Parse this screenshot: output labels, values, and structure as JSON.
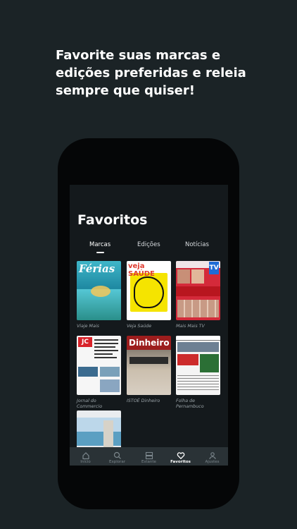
{
  "headline": "Favorite suas marcas e edições preferidas e releia sempre que quiser!",
  "screen": {
    "title": "Favoritos",
    "tabs": [
      {
        "label": "Marcas",
        "active": true
      },
      {
        "label": "Edições",
        "active": false
      },
      {
        "label": "Notícias",
        "active": false
      }
    ],
    "items": [
      {
        "name": "Viaje Mais",
        "cover_text": "Férias"
      },
      {
        "name": "Veja Saúde",
        "cover_text": "veja SAÚDE"
      },
      {
        "name": "Mais Mais TV",
        "cover_text": "TV"
      },
      {
        "name": "Jornal do Commercio",
        "cover_text": "JC"
      },
      {
        "name": "ISTOÉ Dinheiro",
        "cover_text": "Dinheiro"
      },
      {
        "name": "Folha de Pernambuco",
        "cover_text": ""
      },
      {
        "name": "",
        "cover_text": ""
      }
    ],
    "nav": [
      {
        "label": "Início",
        "icon": "home-icon",
        "active": false
      },
      {
        "label": "Explorar",
        "icon": "search-icon",
        "active": false
      },
      {
        "label": "Estante",
        "icon": "shelf-icon",
        "active": false
      },
      {
        "label": "Favoritos",
        "icon": "heart-icon",
        "active": true
      },
      {
        "label": "Ajustes",
        "icon": "user-icon",
        "active": false
      }
    ]
  },
  "colors": {
    "background": "#1b2326",
    "screen": "#14191c",
    "nav_active": "#ffffff",
    "nav_inactive": "#7c878d"
  }
}
